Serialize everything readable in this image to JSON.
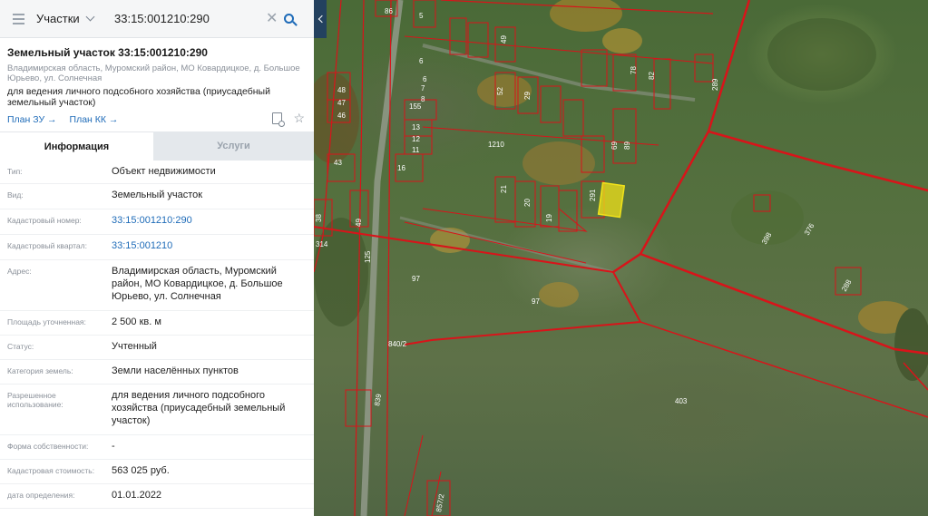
{
  "search": {
    "layer": "Участки",
    "query": "33:15:001210:290"
  },
  "card": {
    "title": "Земельный участок 33:15:001210:290",
    "address": "Владимирская область, Муромский район, МО Ковардицкое, д. Большое Юрьево, ул. Солнечная",
    "use": "для ведения личного подсобного хозяйства (приусадебный земельный участок)",
    "link_zu": "План ЗУ →",
    "link_kk": "План КК →"
  },
  "tabs": {
    "info": "Информация",
    "services": "Услуги"
  },
  "rows": [
    {
      "key": "Тип:",
      "value": "Объект недвижимости"
    },
    {
      "key": "Вид:",
      "value": "Земельный участок"
    },
    {
      "key": "Кадастровый номер:",
      "value": "33:15:001210:290"
    },
    {
      "key": "Кадастровый квартал:",
      "value": "33:15:001210"
    },
    {
      "key": "Адрес:",
      "value": "Владимирская область, Муромский район, МО Ковардицкое, д. Большое Юрьево, ул. Солнечная"
    },
    {
      "key": "Площадь уточненная:",
      "value": "2 500 кв. м"
    },
    {
      "key": "Статус:",
      "value": "Учтенный"
    },
    {
      "key": "Категория земель:",
      "value": "Земли населённых пунктов"
    },
    {
      "key": "Разрешенное использование:",
      "value": "для ведения личного подсобного хозяйства (приусадебный земельный участок)"
    },
    {
      "key": "Форма собственности:",
      "value": "-"
    },
    {
      "key": "Кадастровая стоимость:",
      "value": "563 025 руб."
    },
    {
      "key": "дата определения:",
      "value": "01.01.2022"
    }
  ],
  "map": {
    "boundary_color": "#d8141a",
    "selected_color": "#f0e21a",
    "plot_labels": [
      "86",
      "5",
      "6",
      "49",
      "52",
      "29",
      "82",
      "6",
      "7",
      "8",
      "289",
      "48",
      "47",
      "46",
      "155",
      "13",
      "12",
      "11",
      "1210",
      "16",
      "43",
      "21",
      "20",
      "19",
      "291",
      "38",
      "49",
      "97",
      "97",
      "125",
      "840/2",
      "403",
      "398",
      "376",
      "288",
      "839",
      "857/2",
      "314",
      "78",
      "69",
      "89"
    ]
  }
}
